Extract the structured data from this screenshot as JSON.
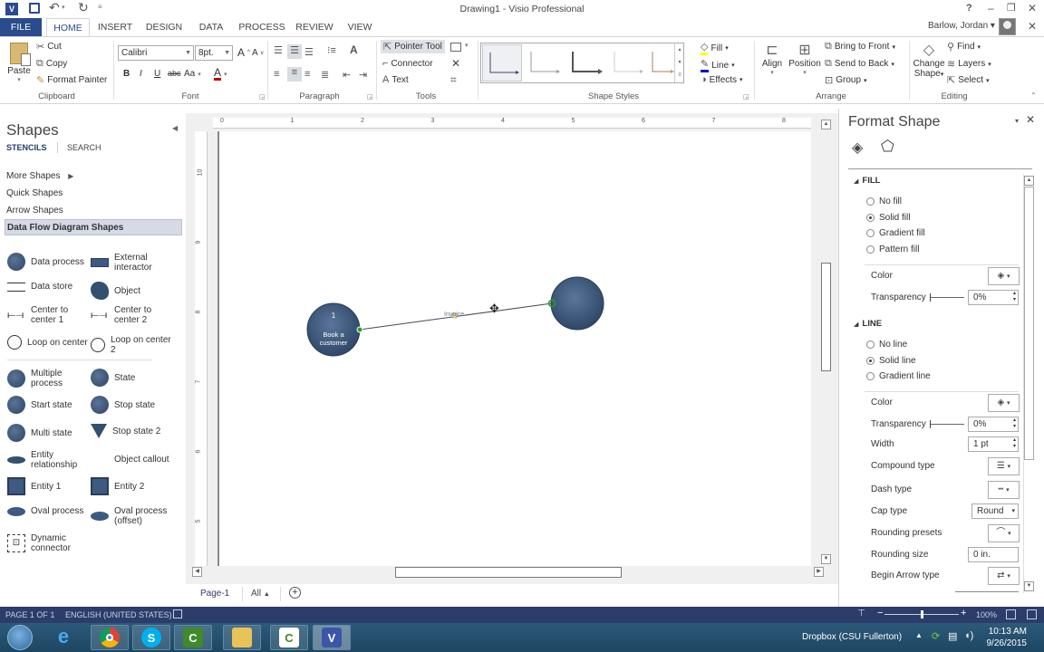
{
  "window": {
    "title": "Drawing1 - Visio Professional",
    "help": "?",
    "user": "Barlow, Jordan",
    "minimize": "–",
    "restore": "❐",
    "close": "✕"
  },
  "tabs": [
    {
      "label": "FILE"
    },
    {
      "label": "HOME"
    },
    {
      "label": "INSERT"
    },
    {
      "label": "DESIGN"
    },
    {
      "label": "DATA"
    },
    {
      "label": "PROCESS"
    },
    {
      "label": "REVIEW"
    },
    {
      "label": "VIEW"
    }
  ],
  "ribbon": {
    "clipboard": {
      "label": "Clipboard",
      "paste": "Paste",
      "cut": "Cut",
      "copy": "Copy",
      "format_painter": "Format Painter"
    },
    "font": {
      "label": "Font",
      "family": "Calibri",
      "size": "8pt.",
      "bold": "B",
      "italic": "I",
      "underline": "U",
      "strike": "abc",
      "case": "Aa",
      "color": "A",
      "grow": "A",
      "shrink": "A"
    },
    "paragraph": {
      "label": "Paragraph"
    },
    "tools": {
      "label": "Tools",
      "pointer": "Pointer Tool",
      "connector": "Connector",
      "text": "Text"
    },
    "shape_styles": {
      "label": "Shape Styles",
      "fill": "Fill",
      "line": "Line",
      "effects": "Effects"
    },
    "arrange": {
      "label": "Arrange",
      "align": "Align",
      "position": "Position",
      "bring_front": "Bring to Front",
      "send_back": "Send to Back",
      "group": "Group"
    },
    "editing": {
      "label": "Editing",
      "change_shape_1": "Change",
      "change_shape_2": "Shape",
      "find": "Find",
      "layers": "Layers",
      "select": "Select"
    }
  },
  "shapes_panel": {
    "title": "Shapes",
    "tab_stencils": "STENCILS",
    "tab_search": "SEARCH",
    "nav": [
      {
        "label": "More Shapes"
      },
      {
        "label": "Quick Shapes"
      },
      {
        "label": "Arrow Shapes"
      },
      {
        "label": "Data Flow Diagram Shapes"
      }
    ],
    "stencils": [
      {
        "label": "Data process",
        "icon": "circle"
      },
      {
        "label": "External interactor",
        "icon": "rect"
      },
      {
        "label": "Data store",
        "icon": "lines"
      },
      {
        "label": "Object",
        "icon": "blob"
      },
      {
        "label": "Center to center 1",
        "icon": "connector"
      },
      {
        "label": "Center to center 2",
        "icon": "connector"
      },
      {
        "label": "Loop on center",
        "icon": "loop"
      },
      {
        "label": "Loop on center 2",
        "icon": "loop"
      },
      {
        "label": "Multiple process",
        "icon": "circle"
      },
      {
        "label": "State",
        "icon": "circle"
      },
      {
        "label": "Start state",
        "icon": "circle"
      },
      {
        "label": "Stop state",
        "icon": "circle"
      },
      {
        "label": "Multi state",
        "icon": "circle"
      },
      {
        "label": "Stop state 2",
        "icon": "triangle"
      },
      {
        "label": "Entity relationship",
        "icon": "diamond"
      },
      {
        "label": "Object callout",
        "icon": "none"
      },
      {
        "label": "Entity 1",
        "icon": "square"
      },
      {
        "label": "Entity 2",
        "icon": "square"
      },
      {
        "label": "Oval process",
        "icon": "oval"
      },
      {
        "label": "Oval process (offset)",
        "icon": "oval"
      },
      {
        "label": "Dynamic connector",
        "icon": "dynconn"
      }
    ]
  },
  "ruler": {
    "h_ticks": [
      "0",
      "1",
      "2",
      "3",
      "4",
      "5",
      "6",
      "7",
      "8"
    ],
    "v_ticks": [
      "10",
      "9",
      "8",
      "7",
      "6",
      "5"
    ]
  },
  "diagram": {
    "process1_number": "1",
    "process1_label": "Book a customer",
    "connector_label": "Invoice"
  },
  "page_tabs": {
    "page": "Page-1",
    "all": "All",
    "add": "+"
  },
  "format_panel": {
    "title": "Format Shape",
    "fill": {
      "header": "FILL",
      "options": [
        {
          "label": "No fill",
          "selected": false
        },
        {
          "label": "Solid fill",
          "selected": true
        },
        {
          "label": "Gradient fill",
          "selected": false
        },
        {
          "label": "Pattern fill",
          "selected": false
        }
      ],
      "color_label": "Color",
      "transparency_label": "Transparency",
      "transparency_value": "0%"
    },
    "line": {
      "header": "LINE",
      "options": [
        {
          "label": "No line",
          "selected": false
        },
        {
          "label": "Solid line",
          "selected": true
        },
        {
          "label": "Gradient line",
          "selected": false
        }
      ],
      "color_label": "Color",
      "transparency_label": "Transparency",
      "transparency_value": "0%",
      "width_label": "Width",
      "width_value": "1 pt",
      "compound_label": "Compound type",
      "dash_label": "Dash type",
      "cap_label": "Cap type",
      "cap_value": "Round",
      "rounding_presets_label": "Rounding presets",
      "rounding_size_label": "Rounding size",
      "rounding_size_value": "0 in.",
      "begin_arrow_label": "Begin Arrow type"
    }
  },
  "statusbar": {
    "page": "PAGE 1 OF 1",
    "language": "ENGLISH (UNITED STATES)",
    "zoom": "100%",
    "zoom_fraction": 0.5
  },
  "taskbar": {
    "apps": [
      "Start",
      "Internet Explorer",
      "Chrome",
      "Skype",
      "Camtasia",
      "File Explorer",
      "Camtasia Recorder",
      "Visio"
    ],
    "tray_text": "Dropbox (CSU Fullerton)",
    "time": "10:13 AM",
    "date": "9/26/2015"
  },
  "colors": {
    "file_tab": "#2a4b8d",
    "statusbar": "#2a3d6b",
    "shape_fill": "#3d5a80",
    "connection_point": "#2aa02a"
  }
}
